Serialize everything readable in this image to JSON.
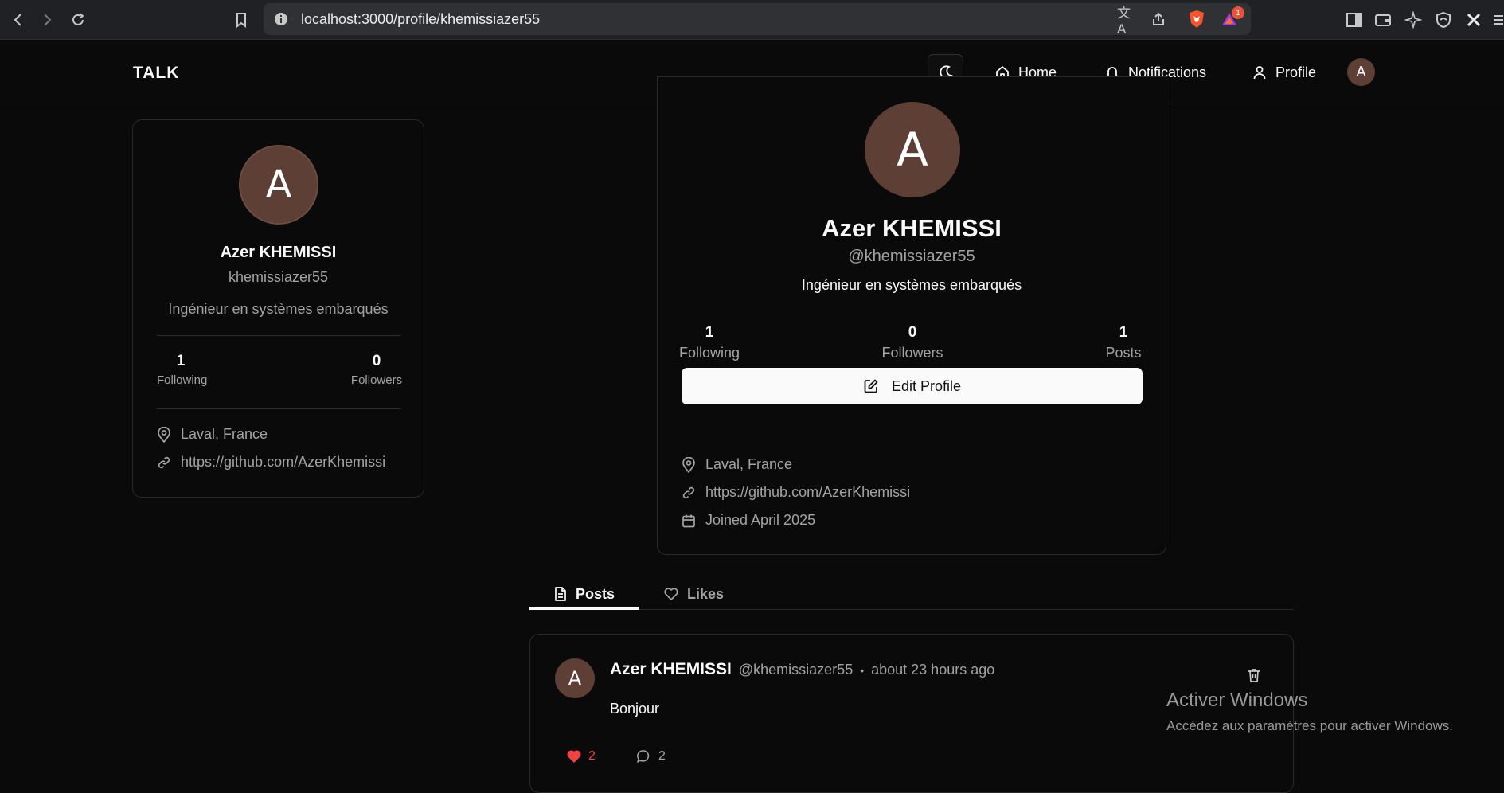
{
  "browser": {
    "url": "localhost:3000/profile/khemissiazer55",
    "notification_count": "1"
  },
  "header": {
    "brand": "TALK",
    "nav": {
      "home": "Home",
      "notifications": "Notifications",
      "profile": "Profile"
    },
    "avatar_initial": "A"
  },
  "sidebar_card": {
    "avatar_initial": "A",
    "name": "Azer KHEMISSI",
    "username": "khemissiazer55",
    "bio": "Ingénieur en systèmes embarqués",
    "following_count": "1",
    "following_label": "Following",
    "followers_count": "0",
    "followers_label": "Followers",
    "location": "Laval, France",
    "website": "https://github.com/AzerKhemissi"
  },
  "profile": {
    "avatar_initial": "A",
    "name": "Azer KHEMISSI",
    "handle": "@khemissiazer55",
    "bio": "Ingénieur en systèmes embarqués",
    "stats": {
      "following_count": "1",
      "following_label": "Following",
      "followers_count": "0",
      "followers_label": "Followers",
      "posts_count": "1",
      "posts_label": "Posts"
    },
    "edit_button": "Edit Profile",
    "location": "Laval, France",
    "website": "https://github.com/AzerKhemissi",
    "joined": "Joined April 2025"
  },
  "tabs": {
    "posts": "Posts",
    "likes": "Likes"
  },
  "post": {
    "avatar_initial": "A",
    "author": "Azer KHEMISSI",
    "handle": "@khemissiazer55",
    "separator": "•",
    "time": "about 23 hours ago",
    "content": "Bonjour",
    "likes": "2",
    "comments": "2"
  },
  "watermark": {
    "title": "Activer Windows",
    "subtitle": "Accédez aux paramètres pour activer Windows."
  },
  "colors": {
    "avatar": "#5d3f36",
    "like": "#ef4444",
    "background": "#0a0a0a"
  }
}
